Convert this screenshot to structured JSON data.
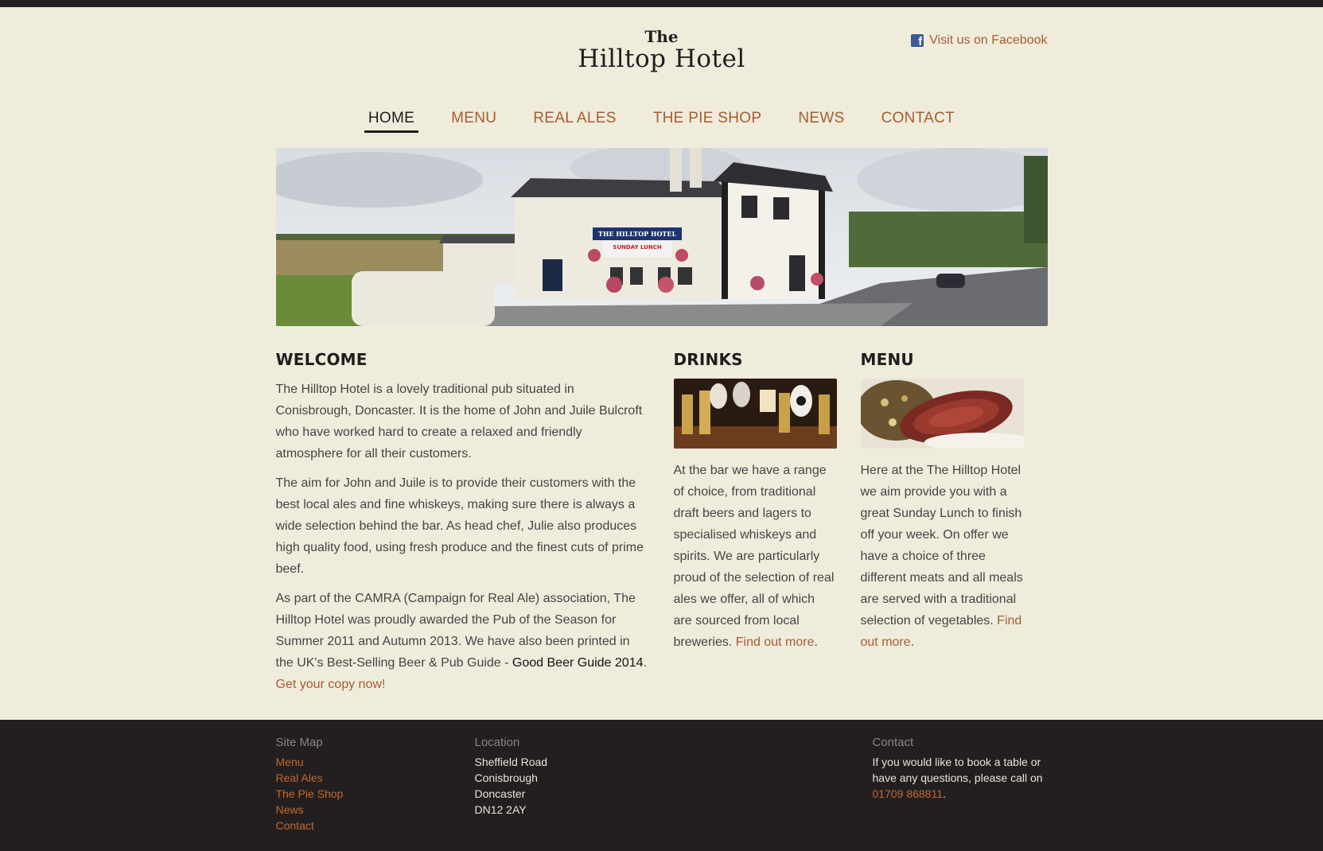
{
  "header": {
    "logo_the": "The",
    "logo_name": "Hilltop Hotel",
    "facebook_label": "Visit us on Facebook"
  },
  "nav": {
    "items": [
      {
        "label": "HOME",
        "active": true
      },
      {
        "label": "MENU"
      },
      {
        "label": "REAL ALES"
      },
      {
        "label": "THE PIE SHOP"
      },
      {
        "label": "NEWS"
      },
      {
        "label": "CONTACT"
      }
    ]
  },
  "hero": {
    "pub_sign": "THE HILLTOP HOTEL",
    "banner": "SUNDAY LUNCH"
  },
  "welcome": {
    "heading": "WELCOME",
    "p1": "The Hilltop Hotel is a lovely traditional pub situated in Conisbrough, Doncaster. It is the home of John and Juile Bulcroft who have worked hard to create a relaxed and friendly atmosphere for all their customers.",
    "p2": "The aim for John and Juile is to provide their customers with the best local ales and fine whiskeys, making sure there is always a wide selection behind the bar. As head chef, Julie also produces high quality food, using fresh produce and the finest cuts of prime beef.",
    "p3_text": "As part of the CAMRA (Campaign for Real Ale) association, The Hilltop Hotel was proudly awarded the Pub of the Season for Summer 2011 and Autumn 2013. We have also been printed in the UK's Best-Selling Beer & Pub Guide - ",
    "p3_strong": "Good Beer Guide 2014",
    "p3_sep": ". ",
    "p3_link": "Get your copy now!"
  },
  "drinks": {
    "heading": "DRINKS",
    "text": "At the bar we have a range of choice, from traditional draft beers and lagers to specialised whiskeys and spirits. We are particularly proud of the selection of real ales we offer, all of which are sourced from local breweries. ",
    "link": "Find out more",
    "end": "."
  },
  "menu": {
    "heading": "MENU",
    "text": "Here at the The Hilltop Hotel we aim provide you with a great Sunday Lunch to finish off your week. On offer we have a choice of three different meats and all meals are served with a traditional selection of vegetables. ",
    "link": "Find out more",
    "end": "."
  },
  "footer": {
    "sitemap": {
      "heading": "Site Map",
      "links": [
        "Menu",
        "Real Ales",
        "The Pie Shop",
        "News",
        "Contact"
      ]
    },
    "location": {
      "heading": "Location",
      "lines": [
        "Sheffield Road",
        "Conisbrough",
        "Doncaster",
        "DN12 2AY"
      ]
    },
    "contact": {
      "heading": "Contact",
      "text": "If you would like to book a table or have any questions, please call on ",
      "phone": "01709 868811",
      "end": "."
    }
  },
  "colors": {
    "background": "#f0ecdc",
    "accent": "#a55d2f",
    "footer_bg": "#231f20",
    "dark_text": "#1e1e1e"
  }
}
